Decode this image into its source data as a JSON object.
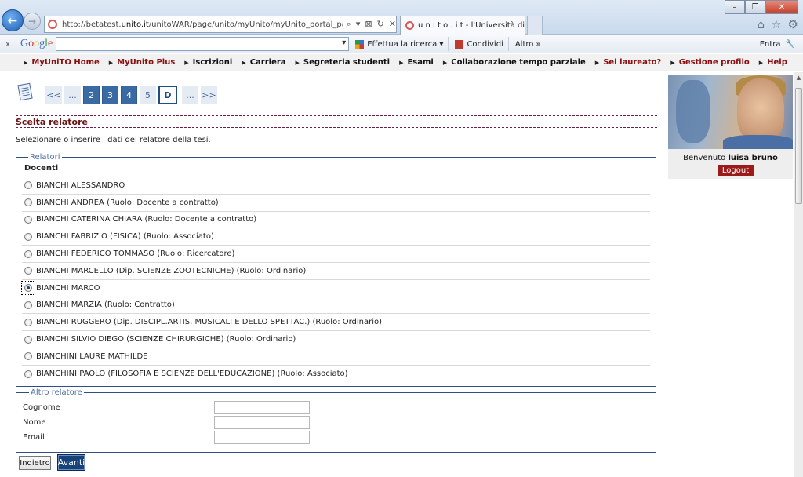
{
  "browser": {
    "url_prefix": "http://betatest.",
    "url_domain": "unito.it",
    "url_rest": "/unitoWAR/page/unito/myUnito/myUnito_portal_page_segrete",
    "tab_title": "u n i t o . i t - l'Università di ...",
    "tab_close": "✕",
    "back_glyph": "←",
    "forward_glyph": "→",
    "window_controls": [
      "–",
      "❐",
      "✕"
    ],
    "right_icons": [
      "⌂",
      "☆",
      "⚙"
    ],
    "address_tools": [
      "⌕",
      "▾",
      "⊠",
      "↻",
      "✕"
    ]
  },
  "google_toolbar": {
    "close_glyph": "x",
    "logo_letters": [
      "G",
      "o",
      "o",
      "g",
      "l",
      "e"
    ],
    "search_label": "Effettua la ricerca",
    "share_label": "Condividi",
    "more_label": "Altro »",
    "signin_label": "Entra",
    "wrench_glyph": "🔧"
  },
  "site_menu": [
    {
      "label": "MyUniTO Home",
      "style": "red"
    },
    {
      "label": "MyUnito Plus",
      "style": "red"
    },
    {
      "label": "Iscrizioni",
      "style": "blk"
    },
    {
      "label": "Carriera",
      "style": "blk"
    },
    {
      "label": "Segreteria studenti",
      "style": "blk"
    },
    {
      "label": "Esami",
      "style": "blk"
    },
    {
      "label": "Collaborazione tempo parziale",
      "style": "blk"
    },
    {
      "label": "Sei laureato?",
      "style": "red"
    },
    {
      "label": "Gestione profilo",
      "style": "red"
    },
    {
      "label": "Help",
      "style": "red"
    }
  ],
  "pager": {
    "first": "<<",
    "ellipsis_left": "...",
    "steps": [
      "2",
      "3",
      "4",
      "5"
    ],
    "current": "D",
    "ellipsis_right": "...",
    "last": ">>"
  },
  "section": {
    "title": "Scelta relatore",
    "instructions": "Selezionare o inserire i dati del relatore della tesi."
  },
  "relatori": {
    "legend": "Relatori",
    "group_label": "Docenti",
    "selected_index": 6,
    "items": [
      "BIANCHI ALESSANDRO",
      "BIANCHI ANDREA (Ruolo: Docente a contratto)",
      "BIANCHI CATERINA CHIARA (Ruolo: Docente a contratto)",
      "BIANCHI FABRIZIO (FISICA) (Ruolo: Associato)",
      "BIANCHI FEDERICO TOMMASO (Ruolo: Ricercatore)",
      "BIANCHI MARCELLO (Dip. SCIENZE ZOOTECNICHE) (Ruolo: Ordinario)",
      "BIANCHI MARCO",
      "BIANCHI MARZIA (Ruolo: Contratto)",
      "BIANCHI RUGGERO (Dip. DISCIPL.ARTIS. MUSICALI E DELLO SPETTAC.) (Ruolo: Ordinario)",
      "BIANCHI SILVIO DIEGO (SCIENZE CHIRURGICHE) (Ruolo: Ordinario)",
      "BIANCHINI LAURE MATHILDE",
      "BIANCHINI PAOLO (FILOSOFIA E SCIENZE DELL'EDUCAZIONE) (Ruolo: Associato)"
    ]
  },
  "altro_relatore": {
    "legend": "Altro relatore",
    "fields": [
      {
        "label": "Cognome",
        "value": ""
      },
      {
        "label": "Nome",
        "value": ""
      },
      {
        "label": "Email",
        "value": ""
      }
    ]
  },
  "buttons": {
    "back": "Indietro",
    "next": "Avanti"
  },
  "user": {
    "welcome_prefix": "Benvenuto",
    "name": "luisa bruno",
    "logout": "Logout"
  },
  "colors": {
    "accent_dark_red": "#8b0f0f",
    "pager_blue": "#3a6aa3",
    "logout_red": "#9b1b1b",
    "avanti_blue": "#17427a"
  }
}
